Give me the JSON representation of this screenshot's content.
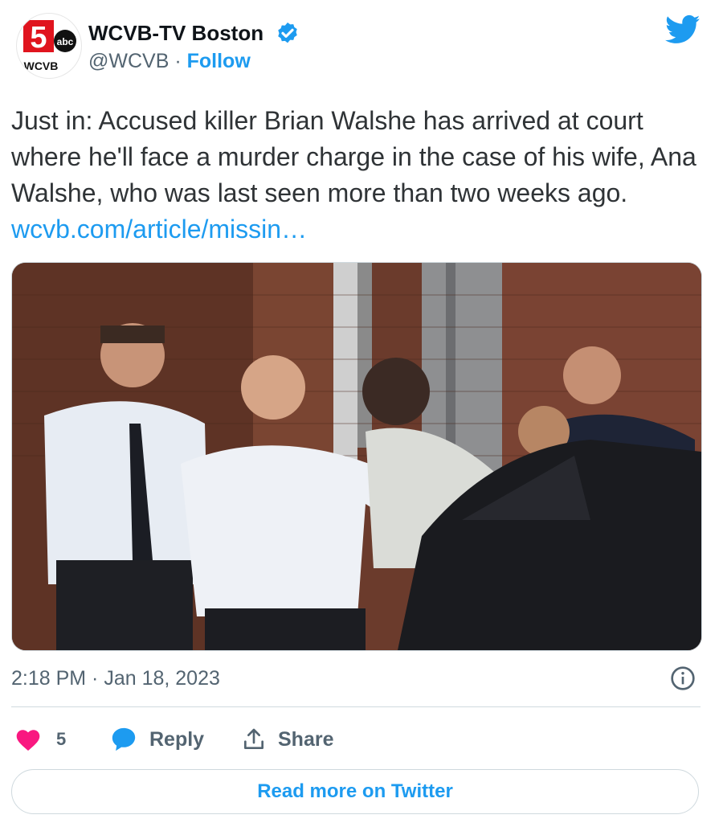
{
  "author": {
    "display_name": "WCVB-TV Boston",
    "handle": "@WCVB",
    "separator": "·",
    "follow_label": "Follow",
    "avatar_text": "WCVB",
    "avatar_network": "abc",
    "avatar_channel": "5",
    "verified": true
  },
  "tweet": {
    "text": "Just in: Accused killer Brian Walshe has arrived at court where he'll face a murder charge in the case of his wife, Ana Walshe, who was last seen more than two weeks ago.",
    "link": "wcvb.com/article/missin…"
  },
  "media": {
    "kind": "photo",
    "subject": "officers escorting man into courthouse"
  },
  "meta": {
    "timestamp": "2:18 PM · Jan 18, 2023"
  },
  "actions": {
    "like_count": "5",
    "reply_label": "Reply",
    "share_label": "Share"
  },
  "read_more_label": "Read more on Twitter",
  "colors": {
    "accent": "#1d9bf0",
    "like": "#f91880",
    "text": "#0f1419",
    "secondary": "#536471",
    "brand_red": "#e0141e"
  }
}
